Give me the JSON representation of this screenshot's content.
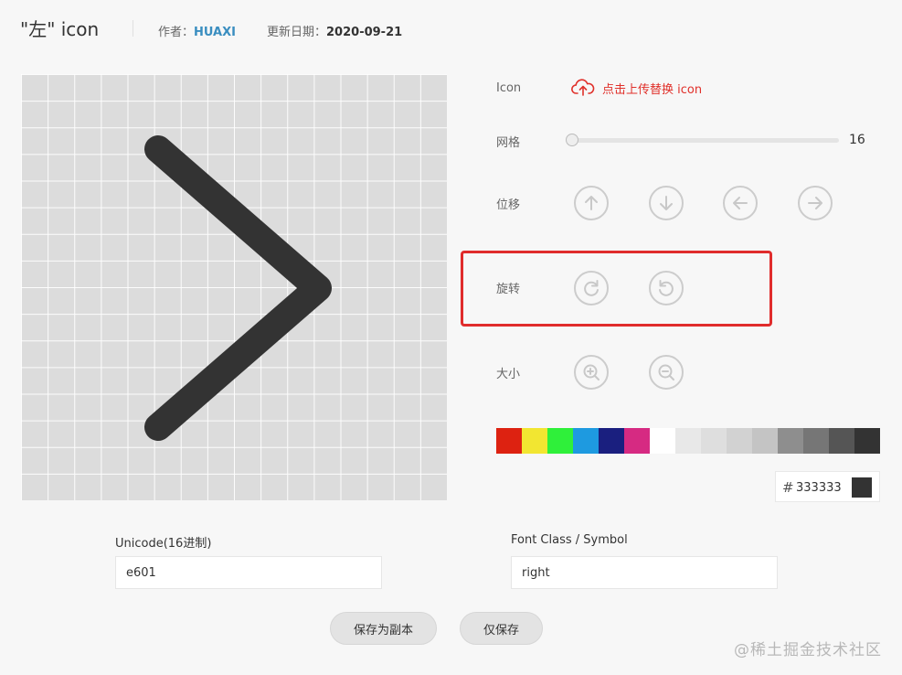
{
  "header": {
    "title": "\"左\" icon",
    "author_label": "作者：",
    "author": "HUAXI",
    "date_label": "更新日期：",
    "date": "2020-09-21"
  },
  "canvas": {
    "grid": 16,
    "glyph": "chevron-right",
    "glyph_color": "#333333",
    "grid_color": "#dcdcdc"
  },
  "controls": {
    "icon_label": "Icon",
    "upload_label": "点击上传替换 icon",
    "upload_icon": "cloud-upload-icon",
    "grid_label": "网格",
    "grid_value": "16",
    "move_label": "位移",
    "move_buttons": [
      "arrow-up-icon",
      "arrow-down-icon",
      "arrow-left-icon",
      "arrow-right-icon"
    ],
    "rotate_label": "旋转",
    "rotate_buttons": [
      "rotate-clockwise-icon",
      "rotate-counterclockwise-icon"
    ],
    "size_label": "大小",
    "size_buttons": [
      "zoom-in-icon",
      "zoom-out-icon"
    ]
  },
  "palette": [
    "#dd2211",
    "#f2e631",
    "#2ff03a",
    "#1e9ae0",
    "#1a1f7f",
    "#d62a82",
    "#ffffff",
    "#e8e8e8",
    "#dedede",
    "#d2d2d2",
    "#c4c4c4",
    "#8e8e8e",
    "#767676",
    "#555555",
    "#333333"
  ],
  "color": {
    "hash": "#",
    "hex": "333333",
    "preview": "#333333"
  },
  "fields": {
    "unicode_label": "Unicode(16进制)",
    "unicode_value": "e601",
    "font_class_label": "Font Class / Symbol",
    "font_class_value": "right"
  },
  "buttons": {
    "save_copy": "保存为副本",
    "save_only": "仅保存"
  },
  "highlight_color": "#e02c2c",
  "watermark": "@稀土掘金技术社区"
}
